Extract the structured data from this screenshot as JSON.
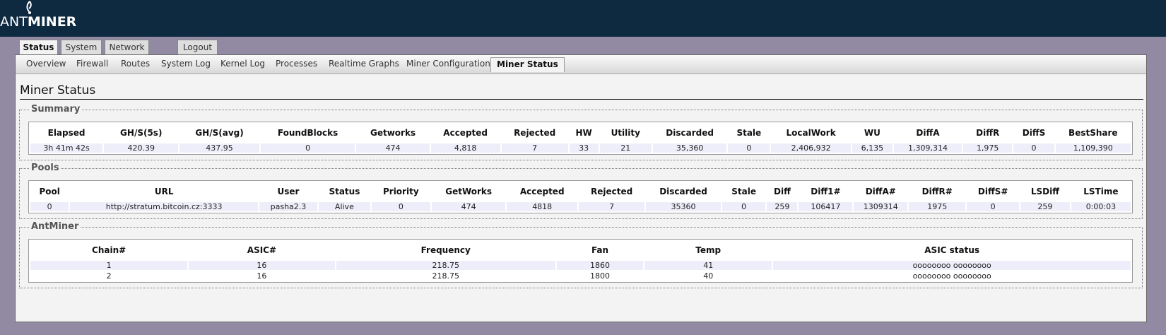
{
  "logo": {
    "prefix": "ANT",
    "suffix": "MINER"
  },
  "main_tabs": [
    {
      "label": "Status",
      "active": true
    },
    {
      "label": "System",
      "active": false
    },
    {
      "label": "Network",
      "active": false
    },
    {
      "label": "Logout",
      "active": false
    }
  ],
  "sub_tabs": [
    {
      "label": "Overview"
    },
    {
      "label": "Firewall"
    },
    {
      "label": "Routes"
    },
    {
      "label": "System Log"
    },
    {
      "label": "Kernel Log"
    },
    {
      "label": "Processes"
    },
    {
      "label": "Realtime Graphs"
    },
    {
      "label": "Miner Configuration"
    },
    {
      "label": "Miner Status",
      "active": true
    }
  ],
  "page_title": "Miner Status",
  "summary": {
    "legend": "Summary",
    "headers": [
      "Elapsed",
      "GH/S(5s)",
      "GH/S(avg)",
      "FoundBlocks",
      "Getworks",
      "Accepted",
      "Rejected",
      "HW",
      "Utility",
      "Discarded",
      "Stale",
      "LocalWork",
      "WU",
      "DiffA",
      "DiffR",
      "DiffS",
      "BestShare"
    ],
    "rows": [
      [
        "3h 41m 42s",
        "420.39",
        "437.95",
        "0",
        "474",
        "4,818",
        "7",
        "33",
        "21",
        "35,360",
        "0",
        "2,406,932",
        "6,135",
        "1,309,314",
        "1,975",
        "0",
        "1,109,390"
      ]
    ]
  },
  "pools": {
    "legend": "Pools",
    "headers": [
      "Pool",
      "URL",
      "User",
      "Status",
      "Priority",
      "GetWorks",
      "Accepted",
      "Rejected",
      "Discarded",
      "Stale",
      "Diff",
      "Diff1#",
      "DiffA#",
      "DiffR#",
      "DiffS#",
      "LSDiff",
      "LSTime"
    ],
    "rows": [
      [
        "0",
        "http://stratum.bitcoin.cz:3333",
        "pasha2.3",
        "Alive",
        "0",
        "474",
        "4818",
        "7",
        "35360",
        "0",
        "259",
        "106417",
        "1309314",
        "1975",
        "0",
        "259",
        "0:00:03"
      ]
    ]
  },
  "antminer": {
    "legend": "AntMiner",
    "headers": [
      "Chain#",
      "ASIC#",
      "Frequency",
      "Fan",
      "Temp",
      "ASIC status"
    ],
    "rows": [
      [
        "1",
        "16",
        "218.75",
        "1860",
        "41",
        "oooooooo oooooooo"
      ],
      [
        "2",
        "16",
        "218.75",
        "1800",
        "40",
        "oooooooo oooooooo"
      ]
    ]
  },
  "colors": {
    "header_bg": "#0e2a41",
    "page_bg": "#918aa2",
    "row_bg": "#eeeefa"
  }
}
